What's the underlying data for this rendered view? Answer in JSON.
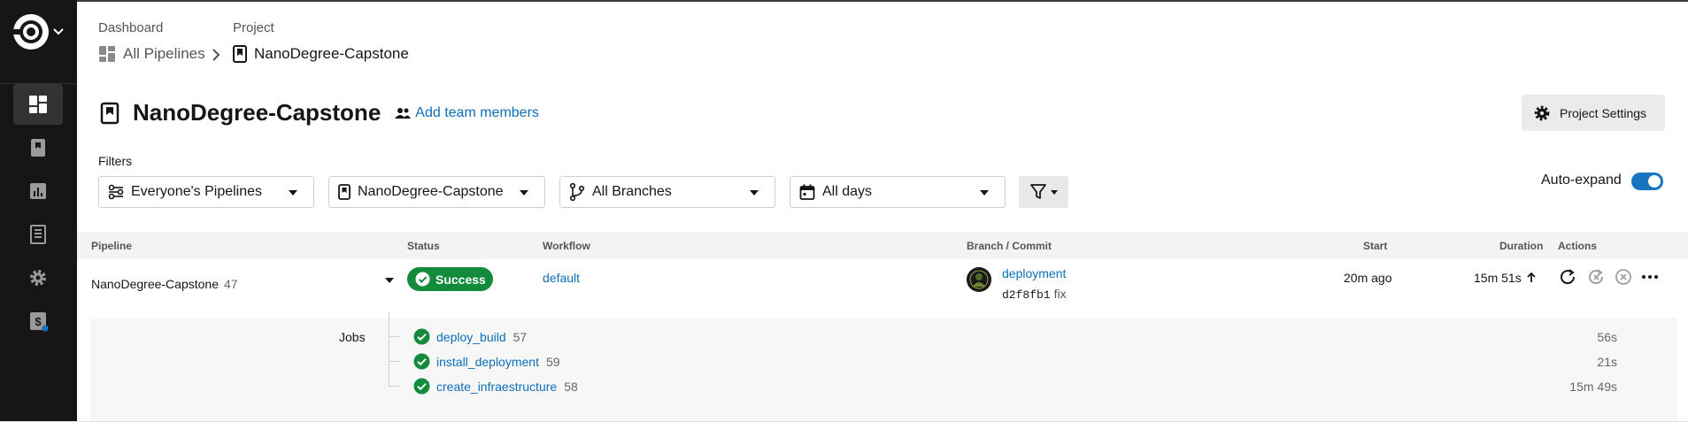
{
  "breadcrumbs": {
    "dashboard_label": "Dashboard",
    "project_label": "Project",
    "all_pipelines": "All Pipelines",
    "project_name": "NanoDegree-Capstone"
  },
  "header": {
    "title": "NanoDegree-Capstone",
    "add_team_members": "Add team members",
    "project_settings": "Project Settings"
  },
  "filters": {
    "label": "Filters",
    "pipelines": "Everyone's Pipelines",
    "project": "NanoDegree-Capstone",
    "branches": "All Branches",
    "days": "All days",
    "auto_expand_label": "Auto-expand",
    "auto_expand": true
  },
  "table": {
    "columns": {
      "pipeline": "Pipeline",
      "status": "Status",
      "workflow": "Workflow",
      "branch_commit": "Branch / Commit",
      "start": "Start",
      "duration": "Duration",
      "actions": "Actions"
    },
    "row": {
      "pipeline": "NanoDegree-Capstone",
      "number": "47",
      "status": "Success",
      "workflow": "default",
      "branch": "deployment",
      "commit_hash": "d2f8fb1",
      "commit_msg": "fix",
      "start": "20m ago",
      "duration": "15m 51s"
    },
    "jobs_label": "Jobs",
    "jobs": [
      {
        "name": "deploy_build",
        "number": "57",
        "duration": "56s"
      },
      {
        "name": "install_deployment",
        "number": "59",
        "duration": "21s"
      },
      {
        "name": "create_infraestructure",
        "number": "58",
        "duration": "15m 49s"
      }
    ]
  },
  "colors": {
    "sidebar_bg": "#161616",
    "link": "#0d6eb8",
    "success": "#138a3c",
    "toggle": "#1774c0"
  },
  "icons": [
    "circleci-logo-icon",
    "dashboard-icon",
    "projects-icon",
    "insights-icon",
    "docs-icon",
    "settings-icon",
    "plan-icon"
  ]
}
